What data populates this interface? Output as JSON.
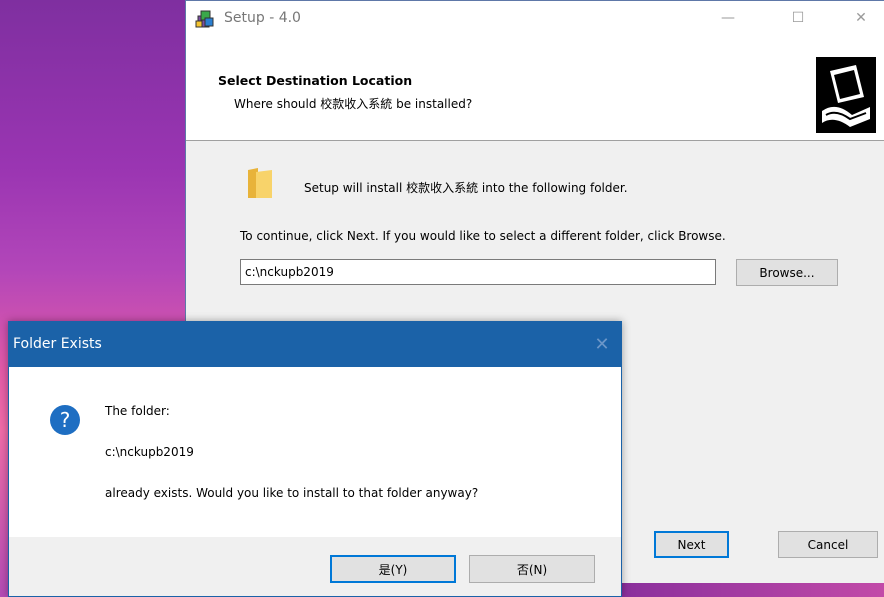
{
  "setup_window": {
    "title": "Setup - 4.0",
    "header_title": "Select Destination Location",
    "header_subtitle": "Where should 校款收入系統 be installed?",
    "install_text": "Setup will install 校款收入系統 into the following folder.",
    "continue_text": "To continue, click Next. If you would like to select a different folder, click Browse.",
    "path_value": "c:\\nckupb2019",
    "browse_label": "Browse...",
    "next_label": "Next",
    "cancel_label": "Cancel",
    "controls": {
      "minimize": "—",
      "maximize": "☐",
      "close": "✕"
    }
  },
  "dialog": {
    "title": "Folder Exists",
    "close": "✕",
    "line1": "The folder:",
    "line2": "c:\\nckupb2019",
    "line3": "already exists. Would you like to install to that folder anyway?",
    "yes_label": "是(Y)",
    "no_label": "否(N)",
    "icon": "question-icon"
  },
  "colors": {
    "dialog_titlebar": "#1b62a8",
    "focus_border": "#0078d7",
    "window_bg": "#f0f0f0"
  }
}
